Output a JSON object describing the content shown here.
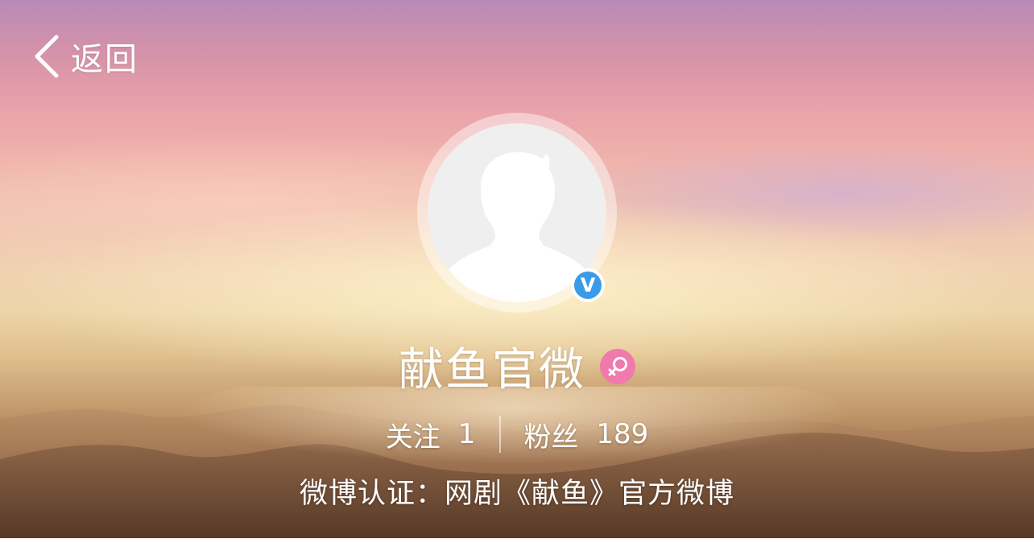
{
  "header": {
    "back_label": "返回"
  },
  "profile": {
    "name": "献鱼官微",
    "verified_badge": "V",
    "gender_icon": "female-icon",
    "following_label": "关注",
    "following_count": "1",
    "followers_label": "粉丝",
    "followers_count": "189",
    "verification": "微博认证：网剧《献鱼》官方微博"
  },
  "colors": {
    "verified_blue": "#3a9be8",
    "gender_pink": "#f07aac",
    "text": "#ffffff"
  }
}
